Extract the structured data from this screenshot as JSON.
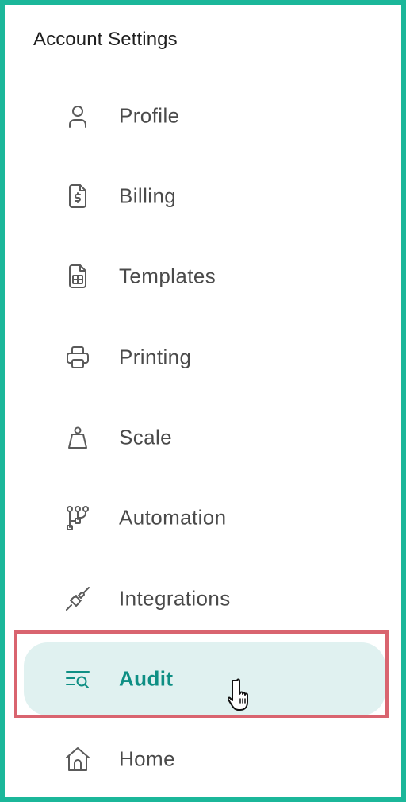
{
  "sidebar": {
    "title": "Account Settings",
    "items": [
      {
        "label": "Profile",
        "icon": "user-icon",
        "active": false
      },
      {
        "label": "Billing",
        "icon": "invoice-icon",
        "active": false
      },
      {
        "label": "Templates",
        "icon": "template-icon",
        "active": false
      },
      {
        "label": "Printing",
        "icon": "printer-icon",
        "active": false
      },
      {
        "label": "Scale",
        "icon": "weight-icon",
        "active": false
      },
      {
        "label": "Automation",
        "icon": "workflow-icon",
        "active": false
      },
      {
        "label": "Integrations",
        "icon": "plug-icon",
        "active": false
      },
      {
        "label": "Audit",
        "icon": "audit-search-icon",
        "active": true
      },
      {
        "label": "Home",
        "icon": "home-icon",
        "active": false
      }
    ]
  },
  "colors": {
    "frame_border": "#1bb79a",
    "active_background": "#e0f1f0",
    "active_text": "#0e8f84",
    "highlight_border": "#d9646f",
    "text": "#4a4a4a"
  }
}
